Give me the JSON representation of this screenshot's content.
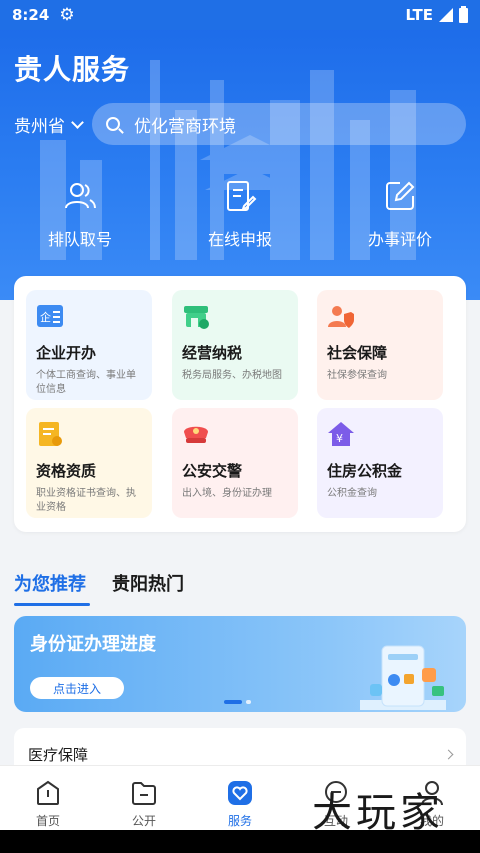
{
  "status_bar": {
    "time": "8:24",
    "network": "LTE"
  },
  "header": {
    "title": "贵人服务",
    "province": "贵州省",
    "search_placeholder": "优化营商环境"
  },
  "quick_actions": [
    {
      "label": "排队取号",
      "icon": "people-icon"
    },
    {
      "label": "在线申报",
      "icon": "edit-document-icon"
    },
    {
      "label": "办事评价",
      "icon": "review-pen-icon"
    }
  ],
  "services": [
    {
      "name": "企业开办",
      "desc": "个体工商查询、事业单位信息",
      "bg": "#eef5ff",
      "icon": "enterprise-icon"
    },
    {
      "name": "经营纳税",
      "desc": "税务局服务、办税地图",
      "bg": "#eafaf2",
      "icon": "shop-icon"
    },
    {
      "name": "社会保障",
      "desc": "社保参保查询",
      "bg": "#fff1ed",
      "icon": "social-security-icon"
    },
    {
      "name": "资格资质",
      "desc": "职业资格证书查询、执业资格",
      "bg": "#fff8e6",
      "icon": "certificate-icon"
    },
    {
      "name": "公安交警",
      "desc": "出入境、身份证办理",
      "bg": "#fff0f0",
      "icon": "police-cap-icon"
    },
    {
      "name": "住房公积金",
      "desc": "公积金查询",
      "bg": "#f3f1ff",
      "icon": "housing-fund-icon"
    }
  ],
  "tabs": {
    "recommend": "为您推荐",
    "hot": "贵阳热门"
  },
  "banner": {
    "title": "身份证办理进度",
    "button": "点击进入"
  },
  "list": {
    "first_item": "医疗保障"
  },
  "bottom_nav": [
    {
      "label": "首页",
      "icon": "home-icon"
    },
    {
      "label": "公开",
      "icon": "folder-icon"
    },
    {
      "label": "服务",
      "icon": "service-heart-icon"
    },
    {
      "label": "互动",
      "icon": "chat-icon"
    },
    {
      "label": "我的",
      "icon": "user-icon"
    }
  ],
  "watermark": "大玩家",
  "colors": {
    "primary": "#1f6fe6",
    "background": "#f2f4f7"
  }
}
